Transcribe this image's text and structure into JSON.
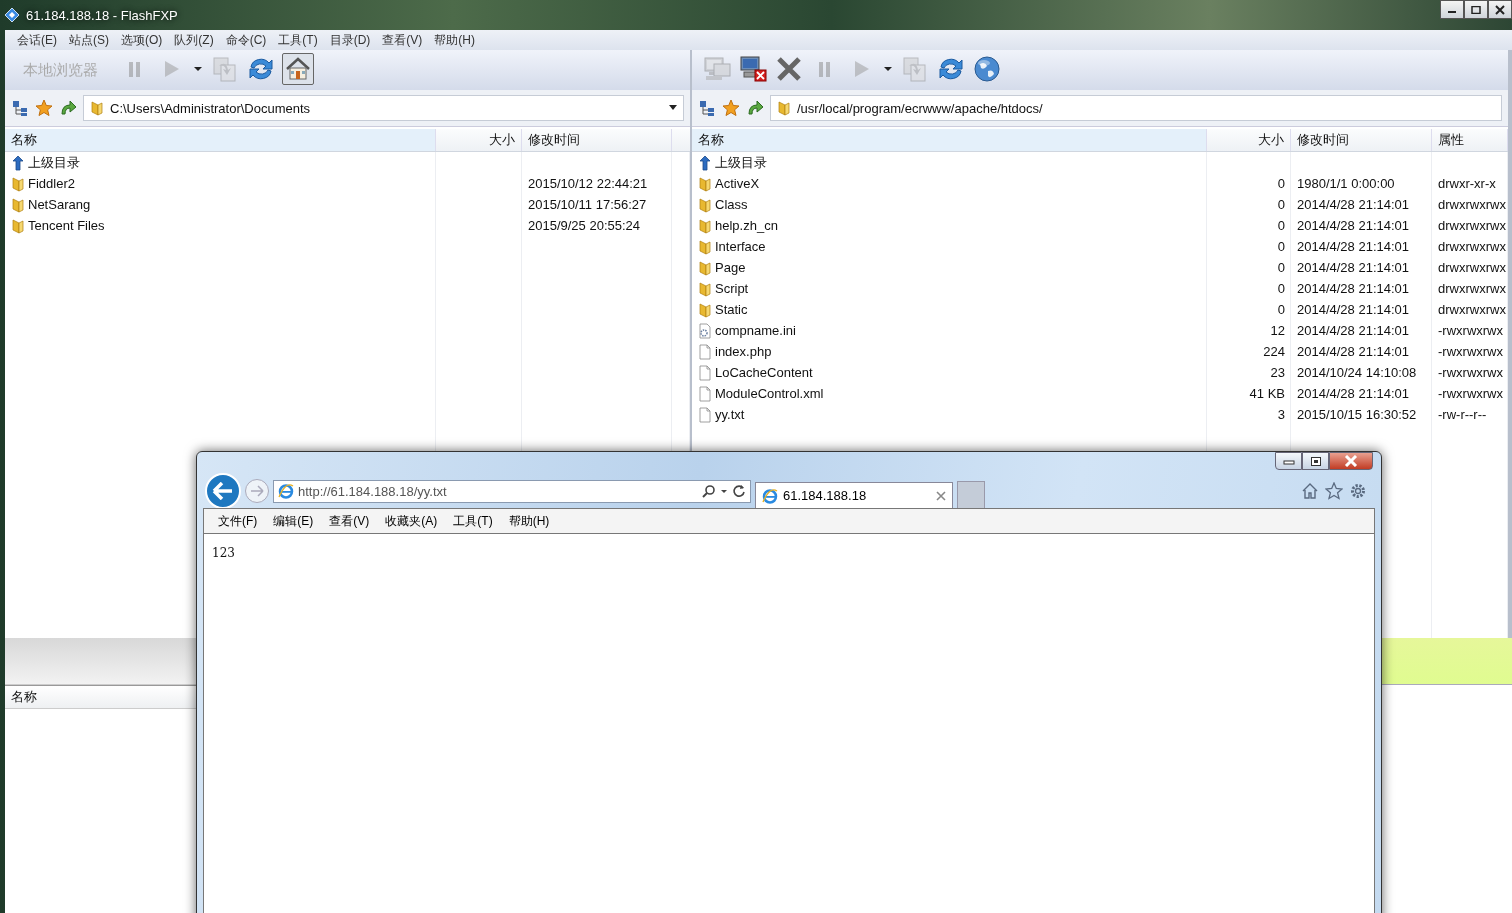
{
  "main_window": {
    "title": "61.184.188.18 - FlashFXP",
    "menu": [
      "会话(E)",
      "站点(S)",
      "选项(O)",
      "队列(Z)",
      "命令(C)",
      "工具(T)",
      "目录(D)",
      "查看(V)",
      "帮助(H)"
    ]
  },
  "local_panel": {
    "browser_label": "本地浏览器",
    "toolbar": [
      {
        "kind": "pause",
        "disabled": true
      },
      {
        "kind": "play",
        "disabled": true
      },
      {
        "kind": "caret",
        "disabled": false
      },
      {
        "kind": "transfer",
        "disabled": true
      },
      {
        "kind": "refresh",
        "disabled": false
      },
      {
        "kind": "home",
        "disabled": false,
        "pressed": true
      }
    ],
    "path": "C:\\Users\\Administrator\\Documents",
    "columns": [
      "名称",
      "大小",
      "修改时间"
    ],
    "rows": [
      {
        "kind": "parent",
        "name": "上级目录"
      },
      {
        "kind": "folder",
        "name": "Fiddler2",
        "modified": "2015/10/12 22:44:21"
      },
      {
        "kind": "folder",
        "name": "NetSarang",
        "modified": "2015/10/11 17:56:27"
      },
      {
        "kind": "folder",
        "name": "Tencent Files",
        "modified": "2015/9/25 20:55:24"
      }
    ]
  },
  "remote_panel": {
    "toolbar": [
      {
        "kind": "connect",
        "disabled": true
      },
      {
        "kind": "disconnect",
        "disabled": false
      },
      {
        "kind": "abort",
        "disabled": false
      },
      {
        "kind": "pause",
        "disabled": true
      },
      {
        "kind": "play",
        "disabled": true
      },
      {
        "kind": "caret",
        "disabled": false
      },
      {
        "kind": "transfer",
        "disabled": true
      },
      {
        "kind": "refresh",
        "disabled": false
      },
      {
        "kind": "globe",
        "disabled": false
      }
    ],
    "path": "/usr/local/program/ecrwww/apache/htdocs/",
    "columns": [
      "名称",
      "大小",
      "修改时间",
      "属性"
    ],
    "rows": [
      {
        "kind": "parent",
        "name": "上级目录"
      },
      {
        "kind": "folder",
        "name": "ActiveX",
        "size": "0",
        "modified": "1980/1/1 0:00:00",
        "attributes": "drwxr-xr-x"
      },
      {
        "kind": "folder",
        "name": "Class",
        "size": "0",
        "modified": "2014/4/28 21:14:01",
        "attributes": "drwxrwxrwx"
      },
      {
        "kind": "folder",
        "name": "help.zh_cn",
        "size": "0",
        "modified": "2014/4/28 21:14:01",
        "attributes": "drwxrwxrwx"
      },
      {
        "kind": "folder",
        "name": "Interface",
        "size": "0",
        "modified": "2014/4/28 21:14:01",
        "attributes": "drwxrwxrwx"
      },
      {
        "kind": "folder",
        "name": "Page",
        "size": "0",
        "modified": "2014/4/28 21:14:01",
        "attributes": "drwxrwxrwx"
      },
      {
        "kind": "folder",
        "name": "Script",
        "size": "0",
        "modified": "2014/4/28 21:14:01",
        "attributes": "drwxrwxrwx"
      },
      {
        "kind": "folder",
        "name": "Static",
        "size": "0",
        "modified": "2014/4/28 21:14:01",
        "attributes": "drwxrwxrwx"
      },
      {
        "kind": "settings",
        "name": "compname.ini",
        "size": "12",
        "modified": "2014/4/28 21:14:01",
        "attributes": "-rwxrwxrwx"
      },
      {
        "kind": "file",
        "name": "index.php",
        "size": "224",
        "modified": "2014/4/28 21:14:01",
        "attributes": "-rwxrwxrwx"
      },
      {
        "kind": "file",
        "name": "LoCacheContent",
        "size": "23",
        "modified": "2014/10/24 14:10:08",
        "attributes": "-rwxrwxrwx"
      },
      {
        "kind": "file",
        "name": "ModuleControl.xml",
        "size": "41 KB",
        "modified": "2014/4/28 21:14:01",
        "attributes": "-rwxrwxrwx"
      },
      {
        "kind": "file",
        "name": "yy.txt",
        "size": "3",
        "modified": "2015/10/15 16:30:52",
        "attributes": "-rw-r--r--"
      }
    ]
  },
  "queue_panel": {
    "columns": [
      "名称"
    ]
  },
  "browser": {
    "url": "http://61.184.188.18/yy.txt",
    "tabs": [
      {
        "title": "61.184.188.18",
        "selected": true
      }
    ],
    "menu": [
      "文件(F)",
      "编辑(E)",
      "查看(V)",
      "收藏夹(A)",
      "工具(T)",
      "帮助(H)"
    ],
    "content": "123"
  }
}
